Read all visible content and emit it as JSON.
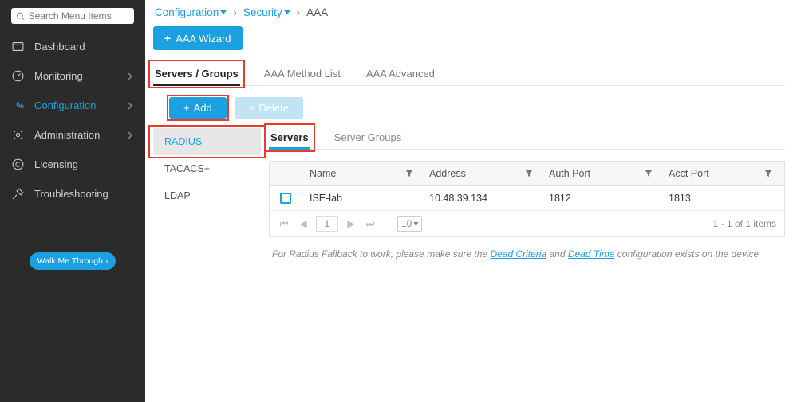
{
  "sidebar": {
    "search_placeholder": "Search Menu Items",
    "items": [
      {
        "label": "Dashboard",
        "icon": "dashboard",
        "expandable": false
      },
      {
        "label": "Monitoring",
        "icon": "gauge",
        "expandable": true
      },
      {
        "label": "Configuration",
        "icon": "wrench",
        "expandable": true,
        "active": true
      },
      {
        "label": "Administration",
        "icon": "gear",
        "expandable": true
      },
      {
        "label": "Licensing",
        "icon": "copyright",
        "expandable": false
      },
      {
        "label": "Troubleshooting",
        "icon": "tools",
        "expandable": false
      }
    ],
    "walk_label": "Walk Me Through ›"
  },
  "breadcrumb": {
    "items": [
      "Configuration",
      "Security"
    ],
    "current": "AAA"
  },
  "wizard_label": "AAA Wizard",
  "tabs": [
    {
      "label": "Servers / Groups"
    },
    {
      "label": "AAA Method List"
    },
    {
      "label": "AAA Advanced"
    }
  ],
  "toolbar": {
    "add_label": "Add",
    "delete_label": "Delete"
  },
  "server_types": [
    {
      "label": "RADIUS"
    },
    {
      "label": "TACACS+"
    },
    {
      "label": "LDAP"
    }
  ],
  "subtabs": [
    {
      "label": "Servers"
    },
    {
      "label": "Server Groups"
    }
  ],
  "table": {
    "columns": [
      "Name",
      "Address",
      "Auth Port",
      "Acct Port"
    ],
    "rows": [
      {
        "name": "ISE-lab",
        "address": "10.48.39.134",
        "auth_port": "1812",
        "acct_port": "1813"
      }
    ],
    "page": "1",
    "page_size": "10",
    "summary": "1 - 1 of 1 items"
  },
  "footnote": {
    "pre": "For Radius Fallback to work, please make sure the ",
    "link1": "Dead Criteria",
    "mid": " and ",
    "link2": "Dead Time",
    "post": " configuration exists on the device"
  }
}
